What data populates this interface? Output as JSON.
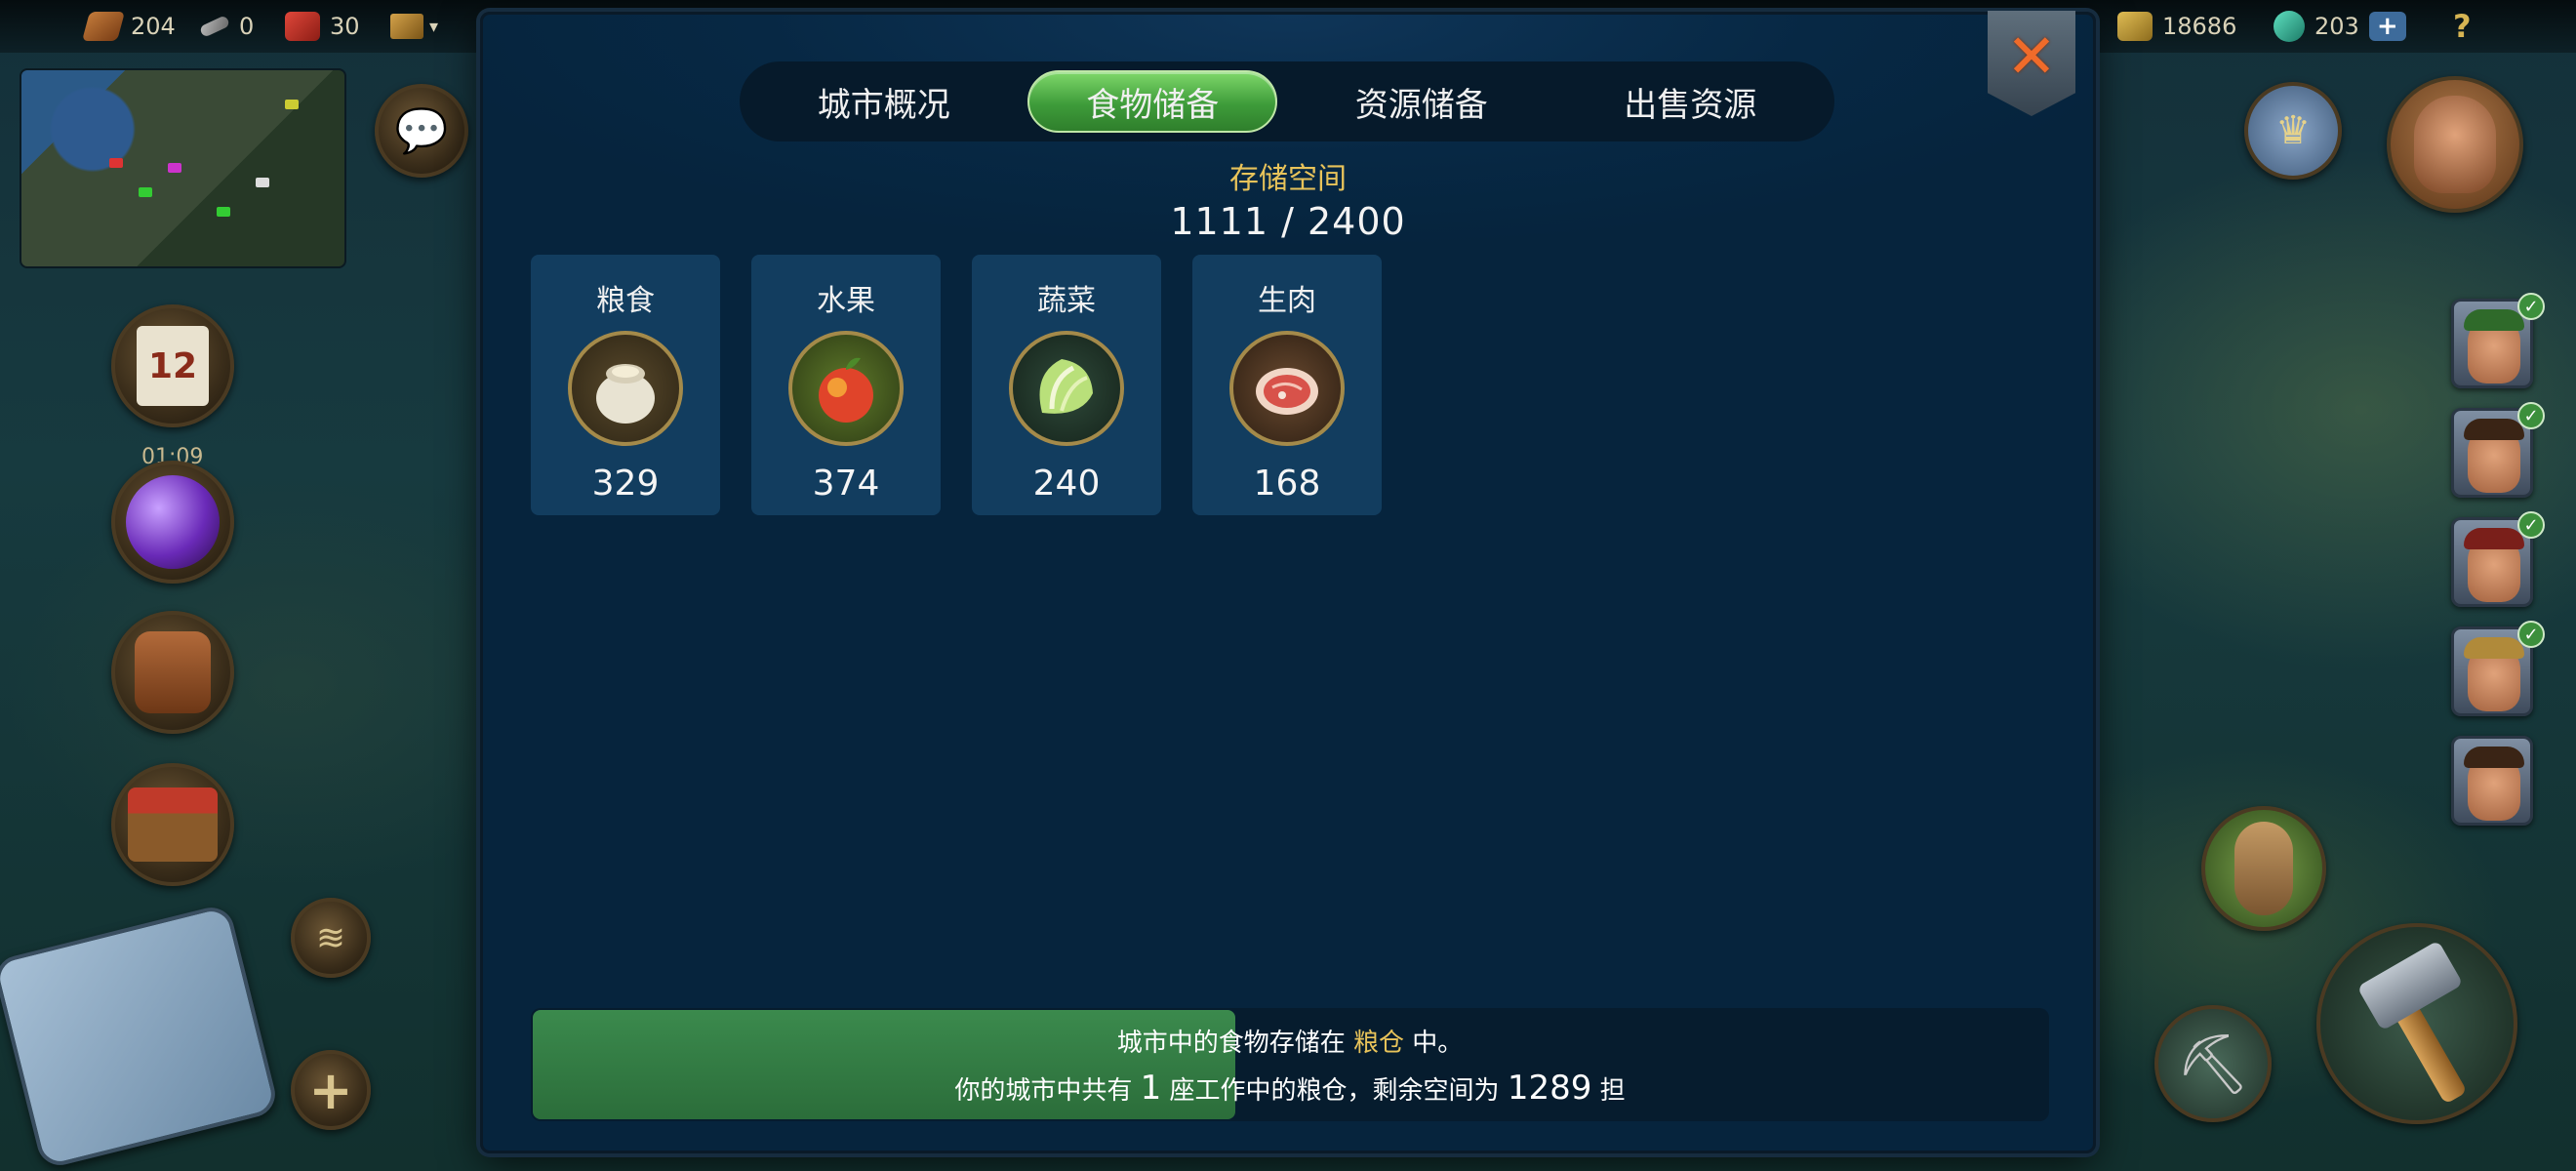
{
  "hud": {
    "resources_left": [
      {
        "icon": "wood-icon",
        "value": "204"
      },
      {
        "icon": "stone-icon",
        "value": "0"
      },
      {
        "icon": "brick-icon",
        "value": "30"
      }
    ],
    "resources_right": [
      {
        "icon": "gold-icon",
        "value": "18686"
      },
      {
        "icon": "gem-icon",
        "value": "203"
      }
    ],
    "plus_label": "+",
    "help_label": "?",
    "calendar_day": "12",
    "timer": "01:09"
  },
  "modal": {
    "tabs": [
      {
        "label": "城市概况",
        "active": false
      },
      {
        "label": "食物储备",
        "active": true
      },
      {
        "label": "资源储备",
        "active": false
      },
      {
        "label": "出售资源",
        "active": false
      }
    ],
    "close_label": "✕",
    "storage_title": "存储空间",
    "storage_value": "1111 / 2400",
    "storage_used": 1111,
    "storage_capacity": 2400,
    "foods": [
      {
        "label": "粮食",
        "value": "329",
        "icon": "grain-sack-icon"
      },
      {
        "label": "水果",
        "value": "374",
        "icon": "apple-icon"
      },
      {
        "label": "蔬菜",
        "value": "240",
        "icon": "cabbage-icon"
      },
      {
        "label": "生肉",
        "value": "168",
        "icon": "raw-meat-icon"
      }
    ],
    "info": {
      "line1_prefix": "城市中的食物存储在",
      "line1_highlight": "粮仓",
      "line1_suffix": "中。",
      "line2_prefix": "你的城市中共有",
      "line2_count": "1",
      "line2_middle": "座工作中的粮仓，剩余空间为",
      "line2_space": "1289",
      "line2_unit": "担"
    }
  }
}
